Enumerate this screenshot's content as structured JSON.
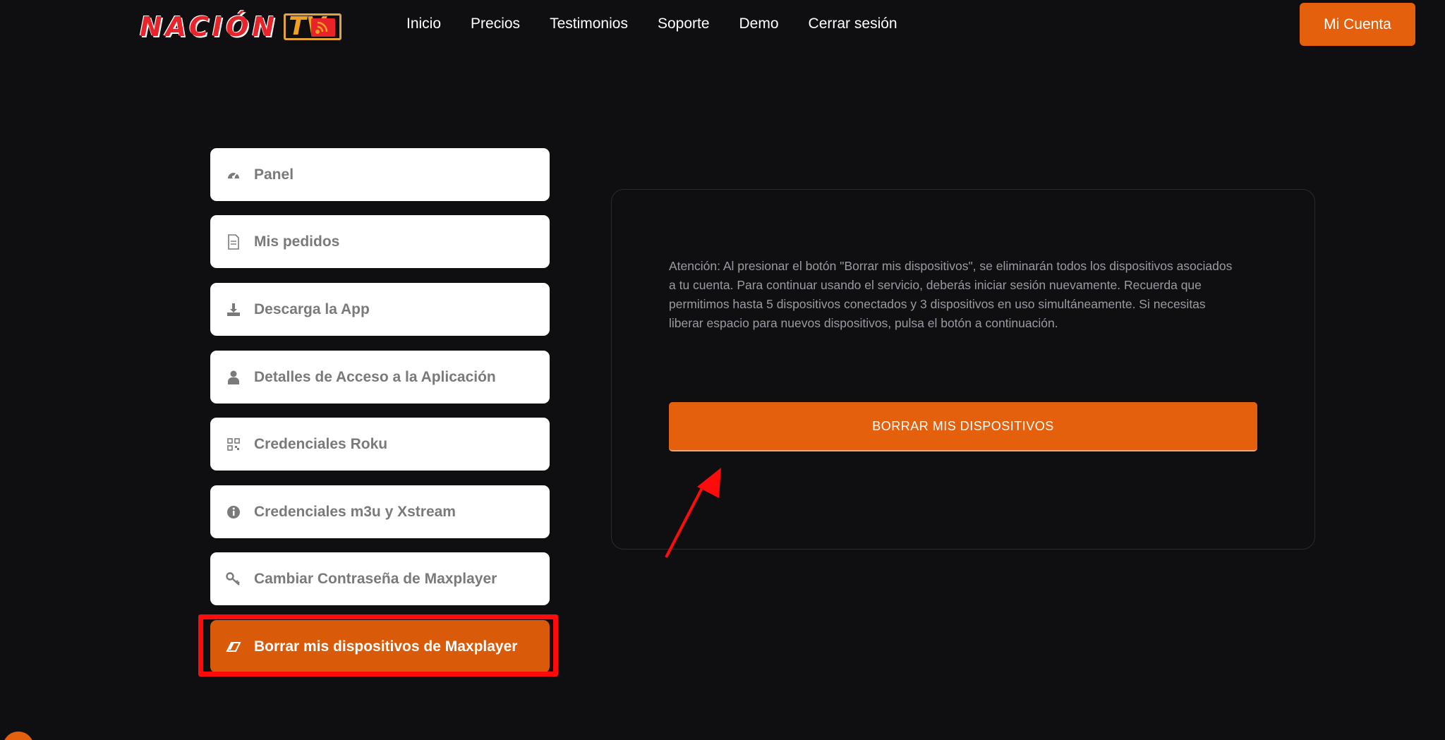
{
  "logo": {
    "text": "NACIÓN",
    "tv": "TV"
  },
  "nav": {
    "items": [
      "Inicio",
      "Precios",
      "Testimonios",
      "Soporte",
      "Demo",
      "Cerrar sesión"
    ],
    "account_label": "Mi Cuenta"
  },
  "sidebar": {
    "items": [
      {
        "label": "Panel",
        "icon": "dashboard-icon"
      },
      {
        "label": "Mis pedidos",
        "icon": "document-icon"
      },
      {
        "label": "Descarga la App",
        "icon": "download-icon"
      },
      {
        "label": "Detalles de Acceso a la Aplicación",
        "icon": "user-icon"
      },
      {
        "label": "Credenciales Roku",
        "icon": "qr-code-icon"
      },
      {
        "label": "Credenciales m3u y Xstream",
        "icon": "info-icon"
      },
      {
        "label": "Cambiar Contraseña de Maxplayer",
        "icon": "key-icon"
      },
      {
        "label": "Borrar mis dispositivos de Maxplayer",
        "icon": "eraser-icon",
        "active": true
      }
    ]
  },
  "main": {
    "notice": "Atención: Al presionar el botón \"Borrar mis dispositivos\", se eliminarán todos los dispositivos asociados a tu cuenta. Para continuar usando el servicio, deberás iniciar sesión nuevamente. Recuerda que permitimos hasta 5 dispositivos conectados y 3 dispositivos en uso simultáneamente. Si necesitas liberar espacio para nuevos dispositivos, pulsa el botón a continuación.",
    "delete_button": "BORRAR MIS DISPOSITIVOS"
  },
  "colors": {
    "background": "#0f0f12",
    "accent": "#e5600c",
    "annotation": "#ff0b0b"
  }
}
